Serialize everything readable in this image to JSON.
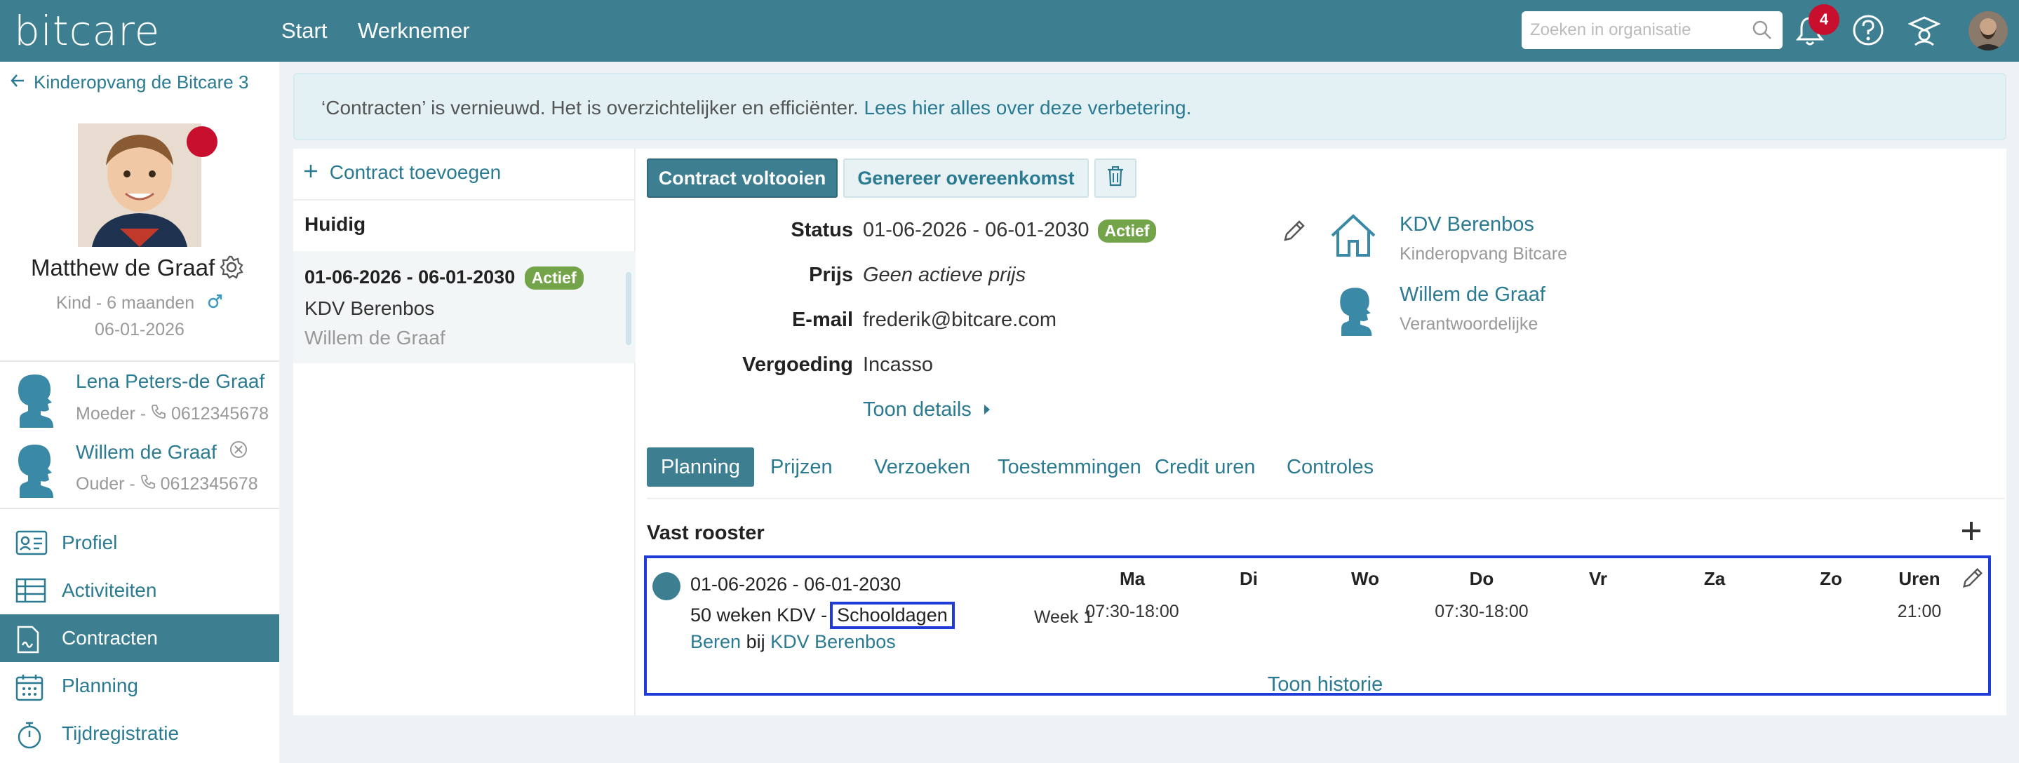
{
  "app": {
    "logo": "bitcare",
    "nav": [
      "Start",
      "Werknemer"
    ],
    "search_placeholder": "Zoeken in organisatie",
    "notifications_count": "4",
    "brand_color": "#3d7f91"
  },
  "sidebar": {
    "back_label": "Kinderopvang de Bitcare 3",
    "child": {
      "name": "Matthew de Graaf",
      "meta": "Kind - 6 maanden",
      "birthdate": "06-01-2026"
    },
    "contacts": [
      {
        "name": "Lena Peters-de Graaf",
        "role": "Moeder - ",
        "phone": "0612345678"
      },
      {
        "name": "Willem de Graaf",
        "role": "Ouder - ",
        "phone": "0612345678"
      }
    ],
    "menu": [
      {
        "label": "Profiel",
        "icon": "id-card-icon"
      },
      {
        "label": "Activiteiten",
        "icon": "table-icon"
      },
      {
        "label": "Contracten",
        "icon": "contract-icon",
        "active": true
      },
      {
        "label": "Planning",
        "icon": "calendar-icon"
      },
      {
        "label": "Tijdregistratie",
        "icon": "stopwatch-icon"
      }
    ]
  },
  "banner": {
    "text": "‘Contracten’ is vernieuwd. Het is overzichtelijker en efficiënter.",
    "link": "Lees hier alles over deze verbetering."
  },
  "contracts": {
    "add_label": "Contract toevoegen",
    "section": "Huidig",
    "items": [
      {
        "dates": "01-06-2026 - 06-01-2030",
        "status": "Actief",
        "location": "KDV Berenbos",
        "person": "Willem de Graaf"
      }
    ]
  },
  "toolbar": {
    "complete_label": "Contract voltooien",
    "generate_label": "Genereer overeenkomst"
  },
  "details": {
    "status_label": "Status",
    "status_dates": "01-06-2026 - 06-01-2030",
    "status_badge": "Actief",
    "prijs_label": "Prijs",
    "prijs_value": "Geen actieve prijs",
    "email_label": "E-mail",
    "email_value": "frederik@bitcare.com",
    "vergoeding_label": "Vergoeding",
    "vergoeding_value": "Incasso",
    "toon_details": "Toon details"
  },
  "orgs": [
    {
      "name": "KDV Berenbos",
      "sub": "Kinderopvang Bitcare"
    },
    {
      "name": "Willem de Graaf",
      "sub": "Verantwoordelijke"
    }
  ],
  "tabs": [
    "Planning",
    "Prijzen",
    "Verzoeken",
    "Toestemmingen",
    "Credit uren",
    "Controles"
  ],
  "schedule": {
    "title": "Vast rooster",
    "dates": "01-06-2026 - 06-01-2030",
    "kdv_prefix": "50 weken KDV -",
    "kdv_highlight": "Schooldagen",
    "group": "Beren",
    "bij": "bij",
    "location": "KDV Berenbos",
    "week": "Week 1",
    "days": [
      "Ma",
      "Di",
      "Wo",
      "Do",
      "Vr",
      "Za",
      "Zo",
      "Uren"
    ],
    "ma": "07:30-18:00",
    "do": "07:30-18:00",
    "uren": "21:00",
    "historie": "Toon historie"
  }
}
